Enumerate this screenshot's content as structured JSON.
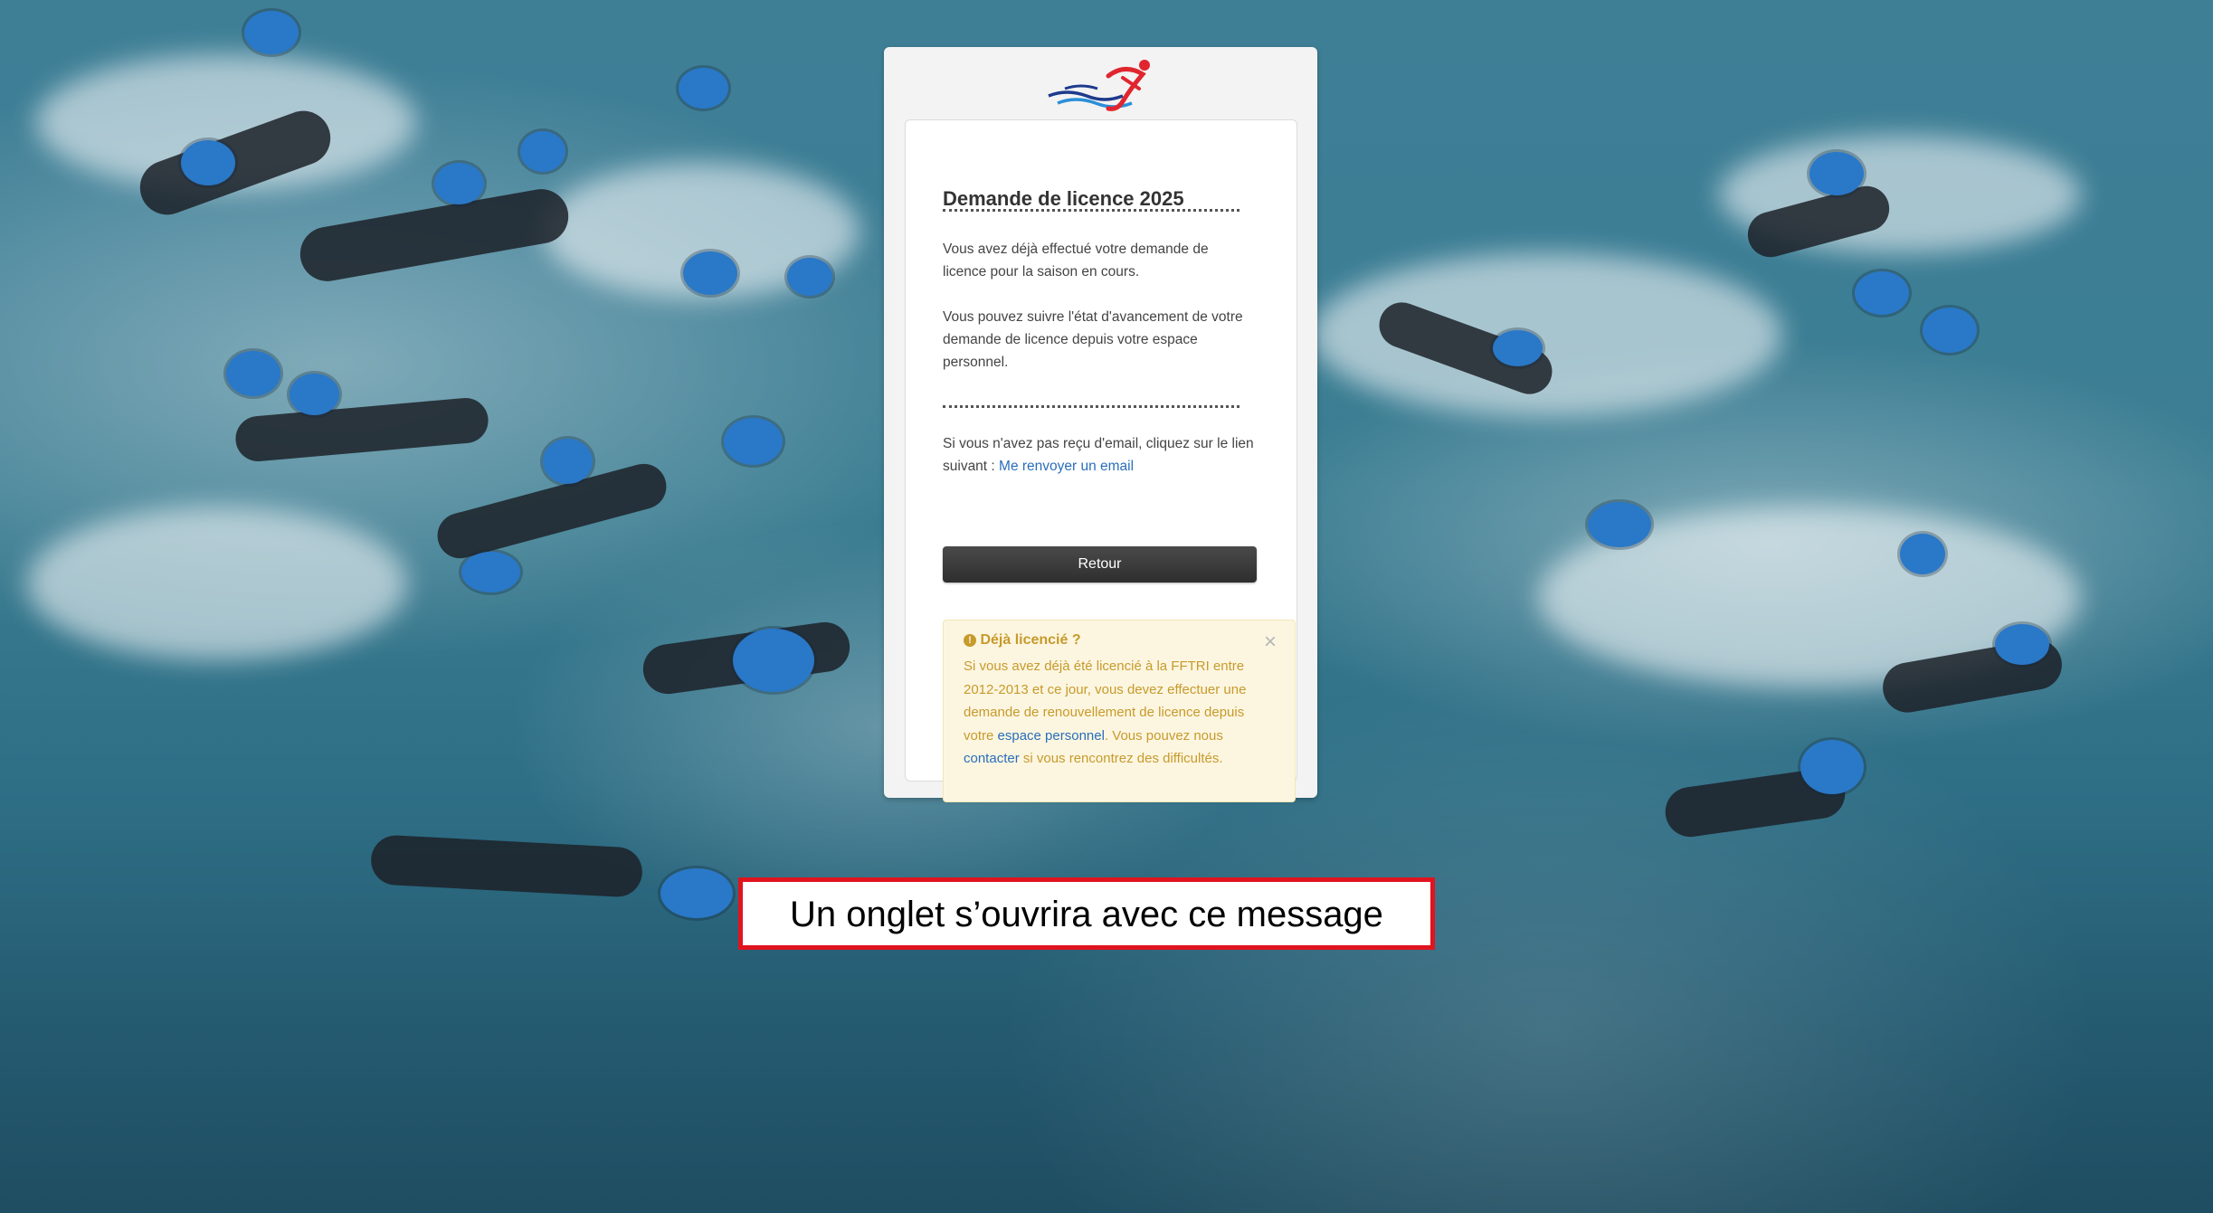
{
  "dialog": {
    "title": "Demande de licence 2025",
    "separator": "********************************************************",
    "paragraph1": "Vous avez déjà effectué votre demande de licence pour la saison en cours.",
    "paragraph2": "Vous pouvez suivre l'état d'avancement de votre demande de licence depuis votre espace personnel.",
    "resend_text": "Si vous n'avez pas reçu d'email, cliquez sur le lien suivant : ",
    "resend_link": "Me renvoyer un email",
    "back_button": "Retour"
  },
  "alert": {
    "icon": "info-circle-icon",
    "title": "Déjà licencié ?",
    "close": "×",
    "body_part1": "Si vous avez déjà été licencié à la FFTRI entre 2012-2013 et ce jour, vous devez effectuer une demande de renouvellement de licence depuis votre ",
    "link_personal_space": "espace personnel",
    "body_part2": ". Vous pouvez nous ",
    "link_contact": "contacter",
    "body_part3": " si vous rencontrez des difficultés."
  },
  "caption": {
    "text": "Un onglet s’ouvrira avec ce message"
  },
  "colors": {
    "accent_link": "#2a6ebb",
    "alert_text": "#c79a2c",
    "caption_border": "#e0141f",
    "button_bg": "#333333"
  }
}
